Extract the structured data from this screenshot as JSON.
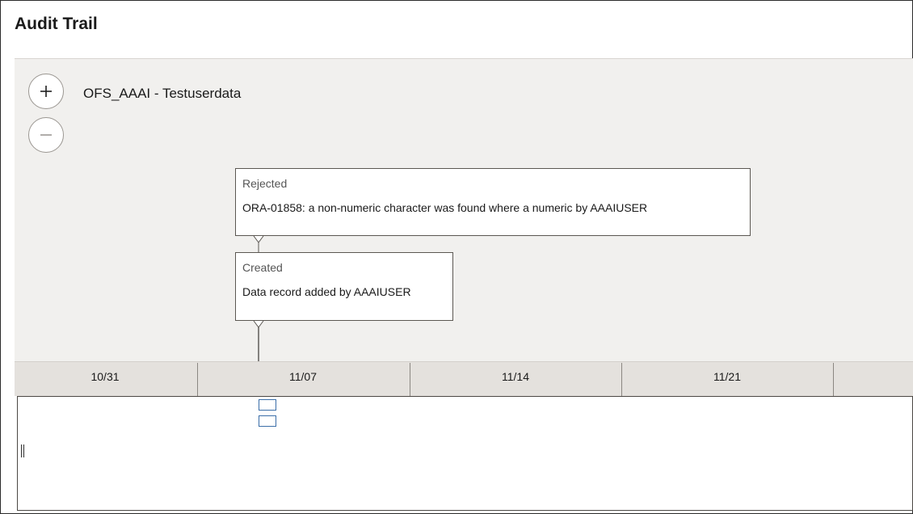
{
  "window": {
    "title": "Audit Trail"
  },
  "timeline": {
    "zoom_in_icon": "plus-icon",
    "zoom_out_icon": "minus-icon",
    "series_label": "OFS_AAAI - Testuserdata",
    "events": [
      {
        "title": "Rejected",
        "description": "ORA-01858: a non-numeric character was found where a numeric by AAAIUSER"
      },
      {
        "title": "Created",
        "description": "Data record added by AAAIUSER"
      }
    ],
    "axis_ticks": [
      "10/31",
      "11/07",
      "11/14",
      "11/21"
    ]
  },
  "colors": {
    "canvas_bg": "#f1f0ee",
    "axis_bg": "#e4e1dd",
    "overview_marker": "#3b6ea8"
  }
}
